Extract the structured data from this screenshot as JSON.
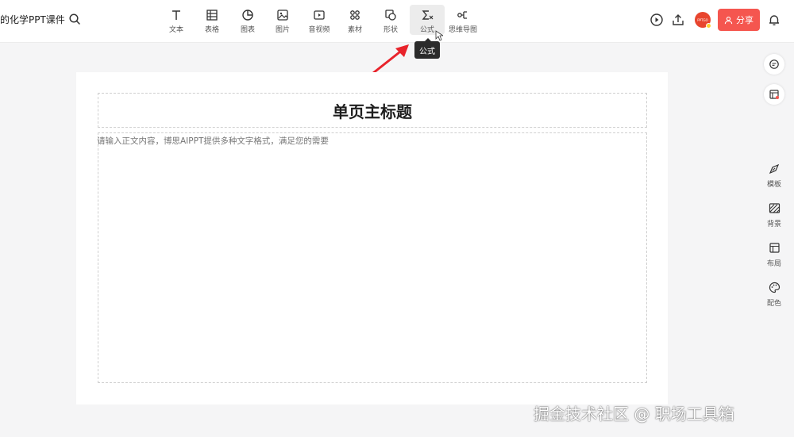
{
  "header": {
    "doc_title": "的化学PPT课件",
    "toolbar": [
      {
        "label": "文本",
        "icon": "text-icon"
      },
      {
        "label": "表格",
        "icon": "table-icon"
      },
      {
        "label": "图表",
        "icon": "chart-icon"
      },
      {
        "label": "图片",
        "icon": "image-icon"
      },
      {
        "label": "音视频",
        "icon": "video-icon"
      },
      {
        "label": "素材",
        "icon": "material-icon"
      },
      {
        "label": "形状",
        "icon": "shape-icon"
      },
      {
        "label": "公式",
        "icon": "formula-icon",
        "active": true
      },
      {
        "label": "思维导图",
        "icon": "mindmap-icon"
      }
    ],
    "avatar_text": "PPTGO",
    "share_label": "分享",
    "accent_color": "#f5564f"
  },
  "tooltip": "公式",
  "slide": {
    "title": "单页主标题",
    "body_placeholder": "请输入正文内容，博思AIPPT提供多种文字格式，满足您的需要"
  },
  "sidebar": {
    "items": [
      {
        "label": "模板",
        "icon": "template-icon"
      },
      {
        "label": "背景",
        "icon": "background-icon"
      },
      {
        "label": "布局",
        "icon": "layout-icon"
      },
      {
        "label": "配色",
        "icon": "palette-icon"
      }
    ]
  },
  "watermark": "掘金技术社区 @ 职场工具箱"
}
